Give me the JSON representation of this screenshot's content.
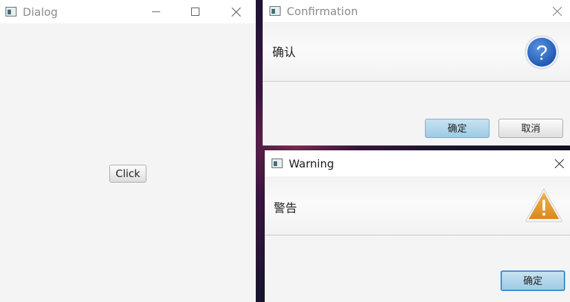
{
  "dialog": {
    "title": "Dialog",
    "click_button": "Click"
  },
  "confirmation": {
    "title": "Confirmation",
    "message": "确认",
    "ok_button": "确定",
    "cancel_button": "取消",
    "icon": "question-icon"
  },
  "warning": {
    "title": "Warning",
    "message": "警告",
    "ok_button": "确定",
    "icon": "warning-icon"
  },
  "colors": {
    "question_blue": "#2f6fc9",
    "warning_orange": "#e39a2a",
    "default_button": "#a7d2e8"
  }
}
